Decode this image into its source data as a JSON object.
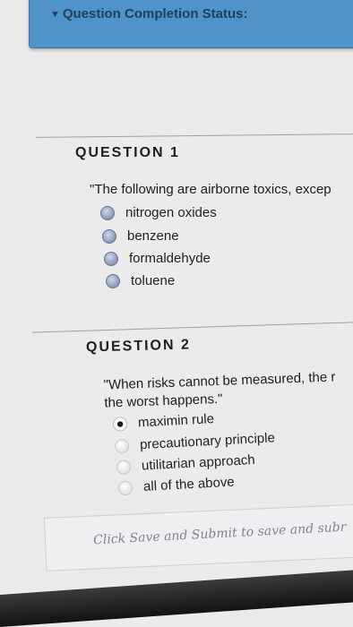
{
  "status": {
    "title": "Question Completion Status:",
    "icon": "chevron-down-icon"
  },
  "questions": [
    {
      "title": "QUESTION 1",
      "text": "\"The following are airborne toxics, excep",
      "options": [
        "nitrogen oxides",
        "benzene",
        "formaldehyde",
        "toluene"
      ]
    },
    {
      "title": "QUESTION 2",
      "text_line1": "\"When risks cannot be measured, the r",
      "text_line2": "the worst happens.\"",
      "options": [
        "maximin rule",
        "precautionary principle",
        "utilitarian approach",
        "all of the above"
      ],
      "selected": "maximin rule"
    }
  ],
  "footer": {
    "text": "Click Save and Submit to save and subr"
  }
}
